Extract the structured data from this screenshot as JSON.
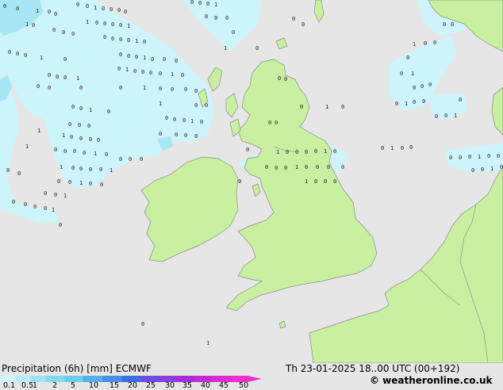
{
  "map": {
    "sea_color": "#e6e6e6",
    "land_color": "#c8f0a0",
    "precip_colors": [
      "#dcf8fc",
      "#bcecf8",
      "#9cdcf4",
      "#7cccf0",
      "#5cacf0"
    ]
  },
  "footer": {
    "title": "Precipitation (6h) [mm] ECMWF",
    "datetime": "Th 23-01-2025 18..00 UTC (00+192)",
    "credit": "© weatheronline.co.uk"
  },
  "legend": {
    "labels": [
      "0.1",
      "0.5",
      "1",
      "2",
      "5",
      "10",
      "15",
      "20",
      "25",
      "30",
      "35",
      "40",
      "45",
      "50"
    ],
    "colors": [
      "#d2f5fb",
      "#b8ecf7",
      "#9fe2f3",
      "#86d8ef",
      "#6dceeb",
      "#5aaee8",
      "#4a8ee5",
      "#3a6ee2",
      "#6a4ee0",
      "#8a3edc",
      "#aa2ed8",
      "#c22ed4",
      "#da2ecf",
      "#f02ecc"
    ]
  }
}
